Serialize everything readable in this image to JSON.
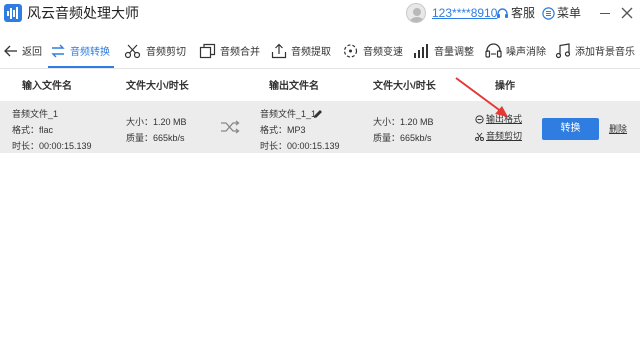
{
  "app": {
    "title": "风云音频处理大师"
  },
  "user": {
    "name": "123****8910"
  },
  "header_actions": {
    "service_label": "客服",
    "menu_label": "菜单"
  },
  "toolbar": {
    "back_label": "返回",
    "items": [
      {
        "label": "音频转换",
        "icon": "audio-convert-icon",
        "active": true
      },
      {
        "label": "音频剪切",
        "icon": "scissors-icon",
        "active": false
      },
      {
        "label": "音频合并",
        "icon": "merge-icon",
        "active": false
      },
      {
        "label": "音频提取",
        "icon": "upload-icon",
        "active": false
      },
      {
        "label": "音频变速",
        "icon": "speed-icon",
        "active": false
      },
      {
        "label": "音量调整",
        "icon": "volume-bars-icon",
        "active": false
      },
      {
        "label": "噪声消除",
        "icon": "noise-icon",
        "active": false
      },
      {
        "label": "添加背景音乐",
        "icon": "music-note-icon",
        "active": false
      }
    ]
  },
  "table": {
    "headers": {
      "input_name": "输入文件名",
      "size_duration": "文件大小/时长",
      "output_name": "输出文件名",
      "output_size_duration": "文件大小/时长",
      "operation": "操作"
    },
    "row": {
      "input": {
        "name": "音频文件_1",
        "format": "格式：flac",
        "duration": "时长：00:00:15.139"
      },
      "input_meta": {
        "size": "大小：1.20 MB",
        "quality": "质量：665kb/s"
      },
      "output": {
        "name": "音频文件_1_1",
        "format": "格式：MP3",
        "duration": "时长：00:00:15.139"
      },
      "output_meta": {
        "size": "大小：1.20 MB",
        "quality": "质量：665kb/s"
      },
      "ops": {
        "output_format": "输出格式",
        "audio_cut": "音频剪切"
      },
      "convert_label": "转换",
      "delete_label": "删除"
    }
  },
  "colors": {
    "accent": "#2f7de1",
    "row_bg": "#ececec",
    "annotation": "#e53935"
  }
}
